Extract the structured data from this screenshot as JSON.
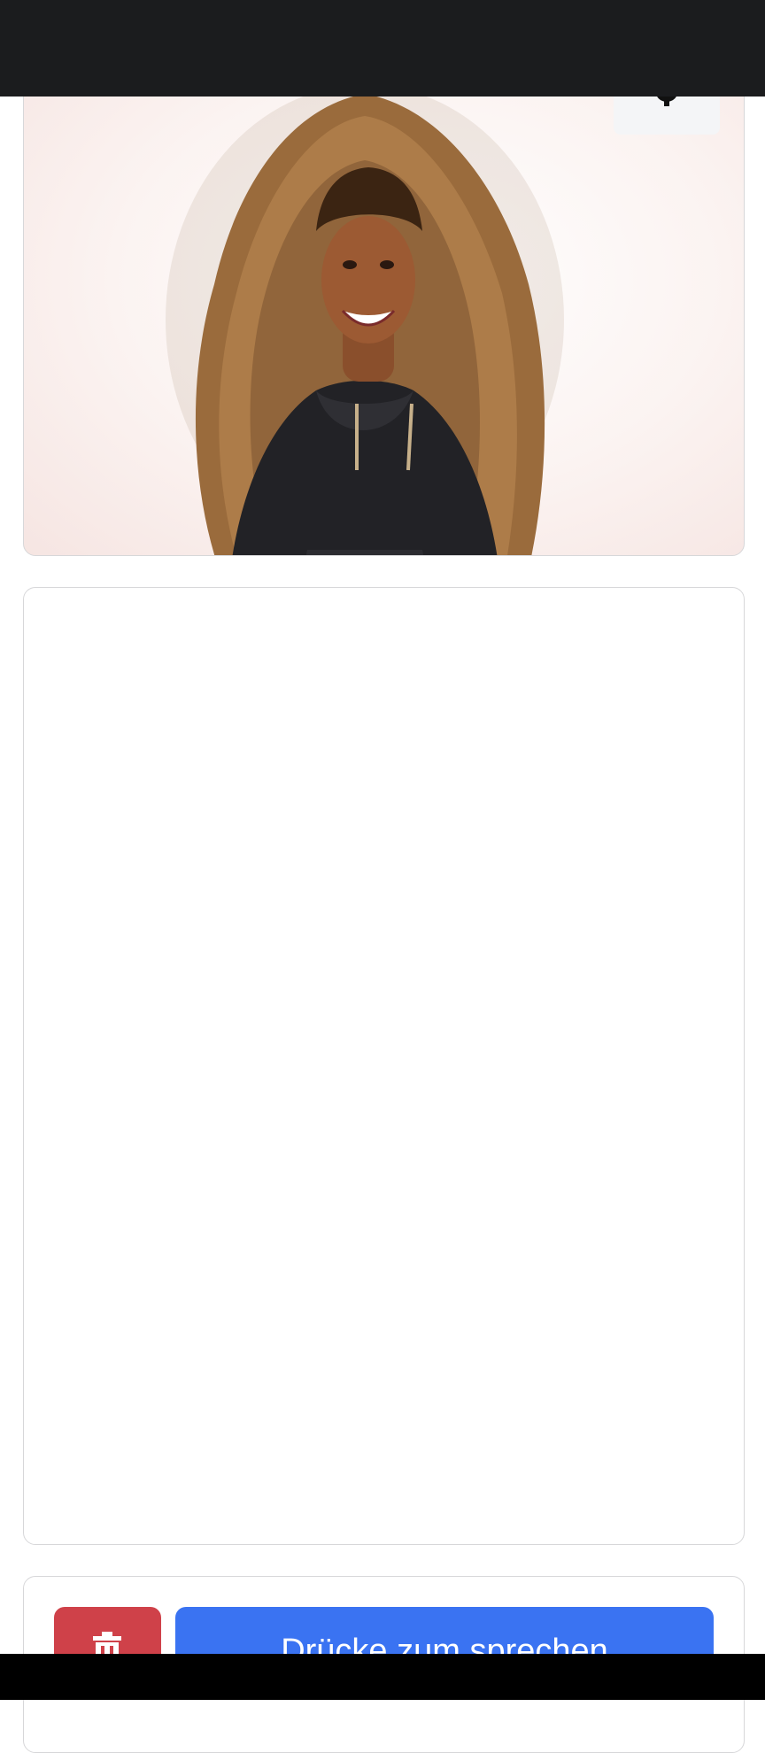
{
  "avatar": {
    "description_icon": "person-portrait",
    "settings_icon": "gear-icon"
  },
  "controls": {
    "delete_icon": "trash-icon",
    "talk_label": "Drücke zum sprechen"
  },
  "colors": {
    "delete": "#cf4149",
    "talk": "#3a73f2",
    "status_bar": "#1b1c1e"
  }
}
